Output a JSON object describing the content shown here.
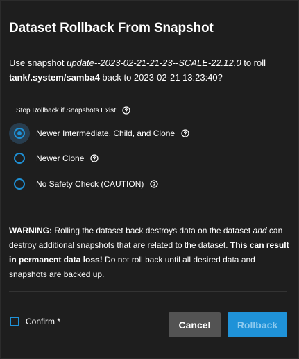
{
  "dialog": {
    "title": "Dataset Rollback From Snapshot",
    "description": {
      "prefix": "Use snapshot ",
      "snapshot": "update--2023-02-21-21-23--SCALE-22.12.0",
      "middle": " to roll ",
      "dataset": "tank/.system/samba4",
      "suffix": " back to 2023-02-21 13:23:40?"
    },
    "options_group": {
      "label": "Stop Rollback if Snapshots Exist:",
      "options": [
        {
          "label": "Newer Intermediate, Child, and Clone",
          "selected": true
        },
        {
          "label": "Newer Clone",
          "selected": false
        },
        {
          "label": "No Safety Check (CAUTION)",
          "selected": false
        }
      ]
    },
    "warning": {
      "heading": "WARNING:",
      "part1": " Rolling the dataset back destroys data on the dataset ",
      "and": "and",
      "part2": " can destroy additional snapshots that are related to the dataset. ",
      "emphasis": "This can result in permanent data loss!",
      "part3": " Do not roll back until all desired data and snapshots are backed up."
    },
    "confirm_label": "Confirm *",
    "confirm_checked": false,
    "buttons": {
      "cancel": "Cancel",
      "rollback": "Rollback"
    }
  },
  "colors": {
    "background": "#1e1e1e",
    "accent": "#1f92d8",
    "cancel_button": "#535353",
    "rollback_disabled_text": "#8fcbef"
  },
  "icons": {
    "help": "help-circle-icon"
  }
}
